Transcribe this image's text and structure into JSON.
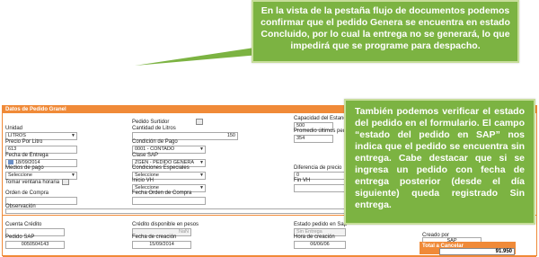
{
  "callout_top": "En la vista de la pestaña flujo de documentos podemos confirmar que el pedido Genera se encuentra en estado Concluido, por lo cual la entrega no se generará, lo que impedirá que se programe para despacho.",
  "callout_right": "También podemos verificar el estado del pedido en el formulario. El campo “estado del pedido en SAP” nos indica que el pedido se encuentra sin entrega. Cabe destacar que si se ingresa un pedido con fecha de entrega posterior (desde el día siguiente) queda registrado Sin entrega.",
  "form": {
    "header": "Datos de Pedido Granel",
    "pedido_surtidor_label": "Pedido Surtidor",
    "capacidad_label": "Capacidad del Estanque",
    "capacidad_value": "500",
    "unidad_label": "Unidad",
    "unidad_value": "LITROS",
    "cantidad_label": "Cantidad de Litros",
    "cantidad_value": "150",
    "promedio_label": "Promedio últimos pedidos",
    "promedio_value": "354",
    "precio_label": "Precio Por Litro",
    "precio_value": "613",
    "condicion_label": "Condición de Pago",
    "condicion_value": "0001 - CONTADO",
    "fecha_entrega_label": "Fecha de Entrega",
    "fecha_entrega_value": "18/09/2014",
    "clase_label": "Clase SAP",
    "clase_value": "ZGEN - PEDIDO GENERA",
    "medios_label": "Medios de pago",
    "medios_value": "Seleccione",
    "condiciones_label": "Condiciones Especiales",
    "condiciones_value": "Seleccione",
    "diferencia_label": "Diferencia de precio",
    "diferencia_value": "0",
    "tomar_label": "Tomar ventana horaria",
    "inicio_label": "Inicio VH",
    "inicio_value": "Seleccione",
    "fin_label": "Fin VH",
    "orden_label": "Orden de Compra",
    "fecha_orden_label": "Fecha Orden de Compra",
    "observacion_label": "Observación",
    "cuenta_label": "Cuenta Crédito",
    "credito_label": "Crédito disponible en pesos",
    "credito_value": "NaN",
    "estado_label": "Estado pedido en Sap",
    "estado_value": "Sin Entrega",
    "pedido_sap_label": "Pedido SAP",
    "pedido_sap_value": "0050504143",
    "fecha_creacion_label": "Fecha de creación",
    "fecha_creacion_value": "15/09/2014",
    "hora_label": "Hora de creación",
    "hora_value": "06/06/06",
    "creado_label": "Creado por",
    "creado_value": "SAP",
    "total_label": "Total a Cancelar",
    "total_value": "91.950"
  },
  "colors": {
    "callout_bg": "#7cb342",
    "form_accent": "#f08a38"
  }
}
